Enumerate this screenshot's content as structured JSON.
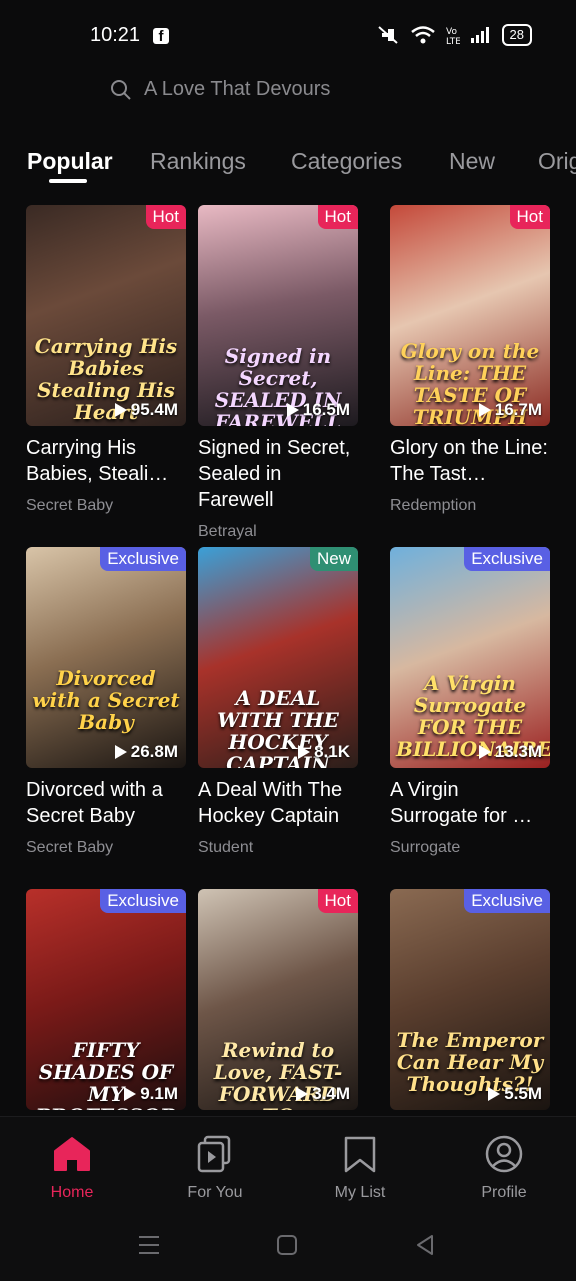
{
  "status": {
    "time": "10:21",
    "battery": "28"
  },
  "search": {
    "placeholder": "A Love That Devours"
  },
  "tabs": [
    {
      "label": "Popular",
      "active": true
    },
    {
      "label": "Rankings"
    },
    {
      "label": "Categories"
    },
    {
      "label": "New"
    },
    {
      "label": "Orig"
    }
  ],
  "cards": [
    {
      "badge": "Hot",
      "poster_title": "Carrying His Babies Stealing His Heart",
      "views": "95.4M",
      "title": "Carrying His Babies, Steali…",
      "category": "Secret Baby"
    },
    {
      "badge": "Hot",
      "poster_title": "Signed in Secret, SEALED IN FAREWELL",
      "views": "16.5M",
      "title": "Signed in Secret, Sealed in Farewell",
      "category": "Betrayal"
    },
    {
      "badge": "Hot",
      "poster_title": "Glory on the Line: THE TASTE OF TRIUMPH",
      "views": "16.7M",
      "title": "Glory on the Line: The Tast…",
      "category": "Redemption"
    },
    {
      "badge": "Exclusive",
      "poster_title": "Divorced with a Secret Baby",
      "views": "26.8M",
      "title": "Divorced with a Secret Baby",
      "category": "Secret Baby"
    },
    {
      "badge": "New",
      "poster_title": "A DEAL WITH THE HOCKEY CAPTAIN",
      "views": "8.1K",
      "title": "A Deal With The Hockey Captain",
      "category": "Student"
    },
    {
      "badge": "Exclusive",
      "poster_title": "A Virgin Surrogate FOR THE BILLIONAIRE",
      "views": "13.3M",
      "title": "A Virgin Surrogate for …",
      "category": "Surrogate"
    },
    {
      "badge": "Exclusive",
      "poster_title": "FIFTY SHADES OF MY PROFESSOR",
      "views": "9.1M",
      "title": "",
      "category": ""
    },
    {
      "badge": "Hot",
      "poster_title": "Rewind to Love, FAST-FORWARD TO FOREVER",
      "views": "3.4M",
      "title": "",
      "category": ""
    },
    {
      "badge": "Exclusive",
      "poster_title": "The Emperor Can Hear My Thoughts?!",
      "views": "5.5M",
      "title": "",
      "category": ""
    }
  ],
  "nav": [
    {
      "label": "Home",
      "icon": "home-icon",
      "active": true
    },
    {
      "label": "For You",
      "icon": "play-stack-icon"
    },
    {
      "label": "My List",
      "icon": "bookmark-icon"
    },
    {
      "label": "Profile",
      "icon": "profile-icon"
    }
  ],
  "colors": {
    "accent": "#e8255a",
    "exclusive": "#5960e4",
    "new": "#2f8f73",
    "background": "#0b0b0c"
  }
}
